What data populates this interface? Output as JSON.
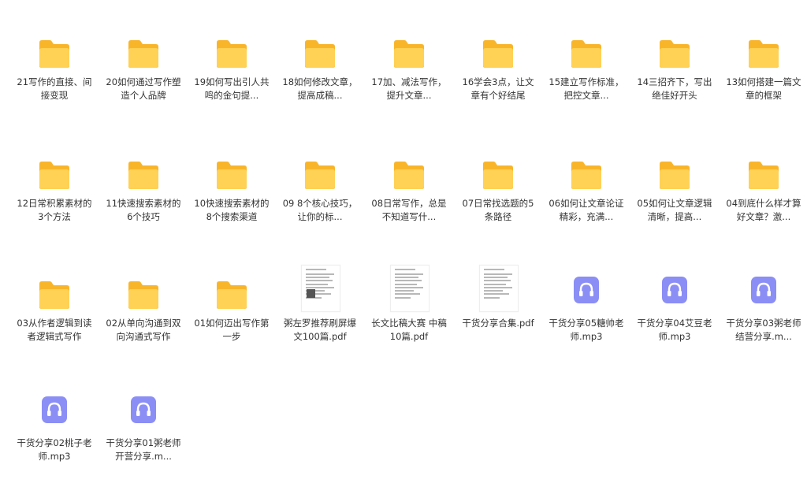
{
  "files": [
    {
      "name": "21写作的直接、间接变现",
      "type": "folder"
    },
    {
      "name": "20如何通过写作塑造个人品牌",
      "type": "folder"
    },
    {
      "name": "19如何写出引人共鸣的金句提...",
      "type": "folder"
    },
    {
      "name": "18如何修改文章，提高成稿...",
      "type": "folder"
    },
    {
      "name": "17加、减法写作，提升文章...",
      "type": "folder"
    },
    {
      "name": "16学会3点，让文章有个好结尾",
      "type": "folder"
    },
    {
      "name": "15建立写作标准，把控文章...",
      "type": "folder"
    },
    {
      "name": "14三招齐下，写出绝佳好开头",
      "type": "folder"
    },
    {
      "name": "13如何搭建一篇文章的框架",
      "type": "folder"
    },
    {
      "name": "12日常积累素材的3个方法",
      "type": "folder"
    },
    {
      "name": "11快速搜索素材的6个技巧",
      "type": "folder"
    },
    {
      "name": "10快速搜索素材的8个搜索渠道",
      "type": "folder"
    },
    {
      "name": "09 8个核心技巧，让你的标...",
      "type": "folder"
    },
    {
      "name": "08日常写作，总是不知道写什...",
      "type": "folder"
    },
    {
      "name": "07日常找选题的5条路径",
      "type": "folder"
    },
    {
      "name": "06如何让文章论证精彩，充满...",
      "type": "folder"
    },
    {
      "name": "05如何让文章逻辑清晰，提高...",
      "type": "folder"
    },
    {
      "name": "04到底什么样才算好文章？激...",
      "type": "folder"
    },
    {
      "name": "03从作者逻辑到读者逻辑式写作",
      "type": "folder"
    },
    {
      "name": "02从单向沟通到双向沟通式写作",
      "type": "folder"
    },
    {
      "name": "01如何迈出写作第一步",
      "type": "folder"
    },
    {
      "name": "粥左罗推荐刷屏爆文100篇.pdf",
      "type": "pdf"
    },
    {
      "name": "长文比稿大赛 中稿10篇.pdf",
      "type": "pdf"
    },
    {
      "name": "干货分享合集.pdf",
      "type": "pdf"
    },
    {
      "name": "干货分享05糖帅老师.mp3",
      "type": "audio"
    },
    {
      "name": "干货分享04艾豆老师.mp3",
      "type": "audio"
    },
    {
      "name": "干货分享03粥老师结营分享.m...",
      "type": "audio"
    },
    {
      "name": "干货分享02桃子老师.mp3",
      "type": "audio"
    },
    {
      "name": "干货分享01粥老师开营分享.m...",
      "type": "audio"
    }
  ],
  "colors": {
    "folder_back": "#F9B52A",
    "folder_front": "#FFD155",
    "audio_bg": "#8B8EF5",
    "text": "#333333"
  }
}
